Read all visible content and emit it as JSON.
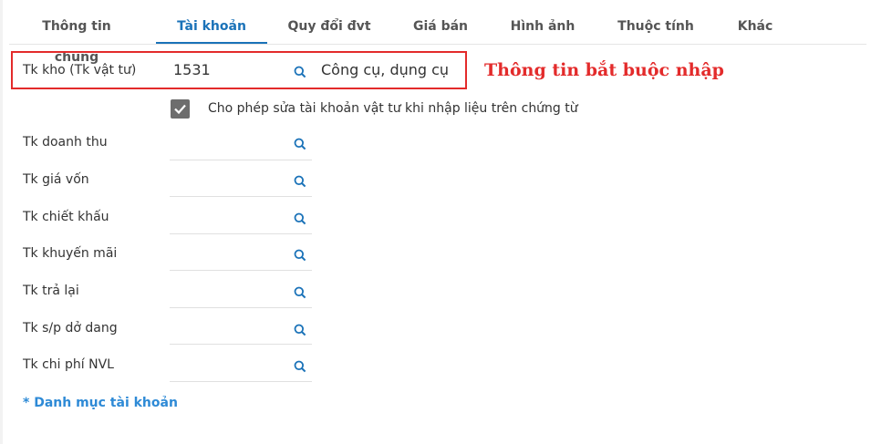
{
  "tabs": [
    {
      "label": "Thông tin chung",
      "active": false
    },
    {
      "label": "Tài khoản",
      "active": true
    },
    {
      "label": "Quy đổi đvt",
      "active": false
    },
    {
      "label": "Giá bán",
      "active": false
    },
    {
      "label": "Hình ảnh",
      "active": false
    },
    {
      "label": "Thuộc tính",
      "active": false
    },
    {
      "label": "Khác",
      "active": false
    }
  ],
  "stock_account": {
    "label": "Tk kho (Tk vật tư)",
    "value": "1531",
    "name": "Công cụ, dụng cụ"
  },
  "annotation": "Thông tin bắt buộc nhập",
  "allow_edit": {
    "checked": true,
    "label": "Cho phép sửa tài khoản vật tư khi nhập liệu trên chứng từ"
  },
  "accounts": [
    {
      "label": "Tk doanh thu",
      "value": ""
    },
    {
      "label": "Tk giá vốn",
      "value": ""
    },
    {
      "label": "Tk chiết khấu",
      "value": ""
    },
    {
      "label": "Tk khuyến mãi",
      "value": ""
    },
    {
      "label": "Tk trả lại",
      "value": ""
    },
    {
      "label": "Tk s/p dở dang",
      "value": ""
    },
    {
      "label": "Tk chi phí NVL",
      "value": ""
    }
  ],
  "footer_link": "* Danh mục tài khoản",
  "colors": {
    "accent": "#1a72b8",
    "required": "#e32b2b",
    "link": "#2e8ad6",
    "icon": "#1a72b8"
  },
  "icons": {
    "search": "search-icon",
    "check": "check-icon"
  }
}
